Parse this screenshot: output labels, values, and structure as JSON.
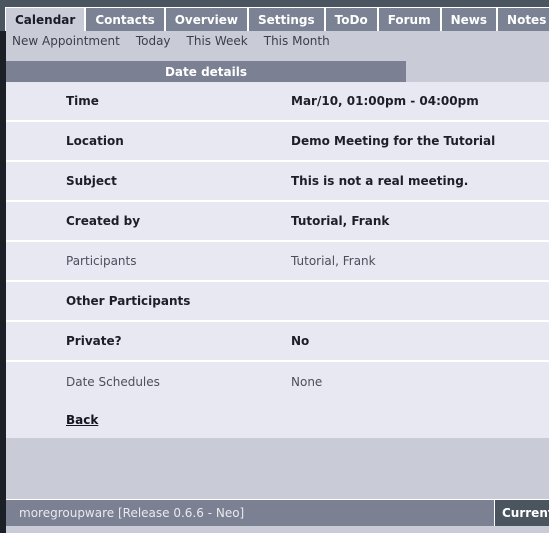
{
  "tabs": [
    {
      "label": "Calendar",
      "active": true
    },
    {
      "label": "Contacts",
      "active": false
    },
    {
      "label": "Overview",
      "active": false
    },
    {
      "label": "Settings",
      "active": false
    },
    {
      "label": "ToDo",
      "active": false
    },
    {
      "label": "Forum",
      "active": false
    },
    {
      "label": "News",
      "active": false
    },
    {
      "label": "Notes",
      "active": false
    }
  ],
  "submenu": [
    {
      "label": "New Appointment"
    },
    {
      "label": "Today"
    },
    {
      "label": "This Week"
    },
    {
      "label": "This Month"
    }
  ],
  "section": {
    "title": "Date details"
  },
  "details": [
    {
      "label": "Time",
      "value": "Mar/10, 01:00pm - 04:00pm",
      "bold": true
    },
    {
      "label": "Location",
      "value": "Demo Meeting for the Tutorial",
      "bold": true
    },
    {
      "label": "Subject",
      "value": "This is not a real meeting.",
      "bold": true
    },
    {
      "label": "Created by",
      "value": "Tutorial, Frank",
      "bold": true
    },
    {
      "label": "Participants",
      "value": "Tutorial, Frank",
      "bold": false
    },
    {
      "label": "Other Participants",
      "value": "",
      "bold": true
    },
    {
      "label": "Private?",
      "value": "No",
      "bold": true
    },
    {
      "label": "Date Schedules",
      "value": "None",
      "bold": false
    }
  ],
  "back": {
    "label": "Back"
  },
  "footer": {
    "left": "moregroupware [Release 0.6.6 - Neo]",
    "right": "Current"
  },
  "colors": {
    "page_background": "#4b5560",
    "tab_inactive": "#7b8293",
    "tab_active": "#c9ccd7",
    "panel_background": "#c9ccd7",
    "row_background": "#e7e8f1",
    "section_header": "#7b8092",
    "footer_bar": "#7b8092",
    "rail": "#1b1f26",
    "text_dark": "#1e1e28",
    "text_muted": "#4b4f5c"
  }
}
